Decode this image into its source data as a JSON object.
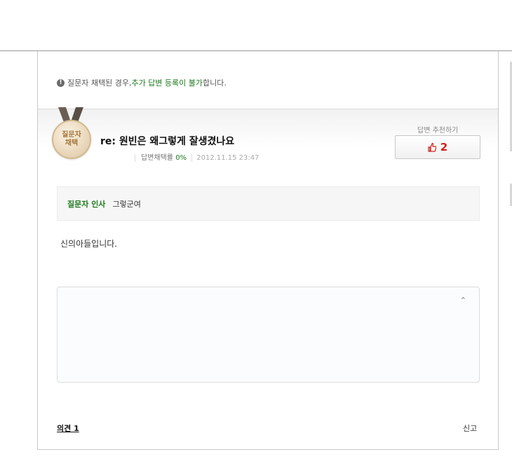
{
  "notice": {
    "icon": "info-icon",
    "prefix": "질문자 채택된 경우, ",
    "highlight": "추가 답변 등록이 불가",
    "suffix": "합니다."
  },
  "medal": {
    "icon": "medal-icon",
    "line1": "질문자",
    "line2": "채택"
  },
  "post": {
    "title": "re: 원빈은 왜그렇게 잘생겼나요",
    "adopt_label": "답변채택률 ",
    "adopt_rate": "0%",
    "date": "2012.11.15 23:47"
  },
  "recommend": {
    "label": "답변 추천하기",
    "icon": "thumb-up-icon",
    "count": "2"
  },
  "greeting": {
    "label": "질문자 인사",
    "text": "그렇군여"
  },
  "answer": {
    "text": "신의아들입니다."
  },
  "comments": {
    "collapse_icon": "chevron-up-icon",
    "opinions_label": "의견 1",
    "report_label": "신고"
  },
  "colors": {
    "accent_green": "#1e7a1e",
    "count_red": "#d0201b",
    "medal_gold": "#a3763a"
  }
}
